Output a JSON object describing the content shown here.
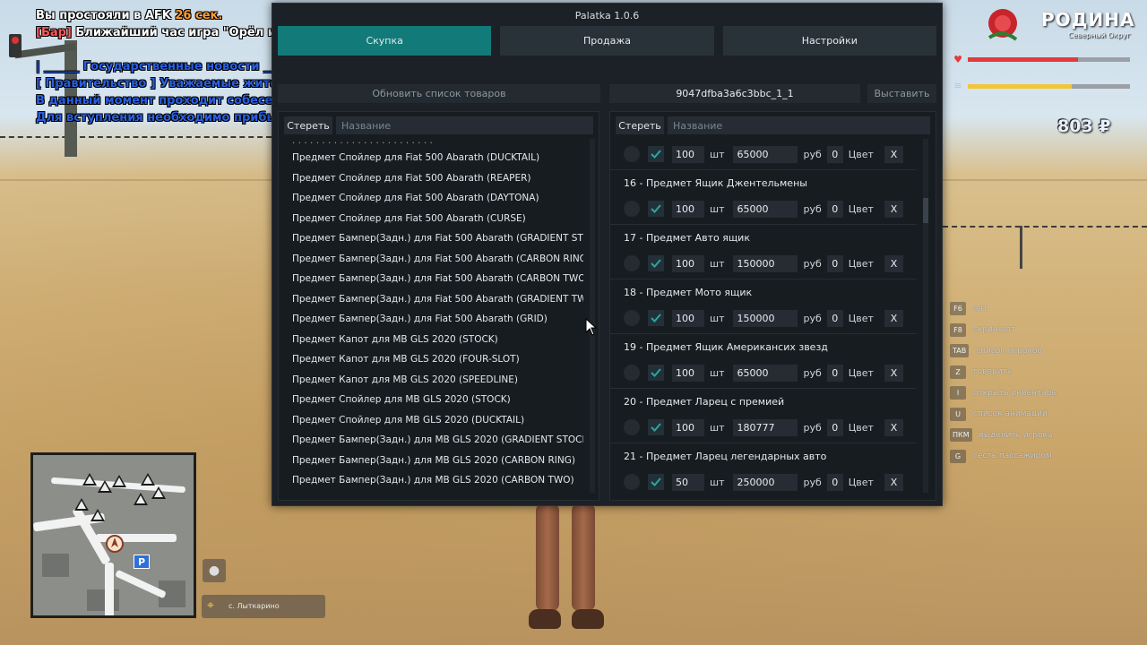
{
  "chat": {
    "line1_prefix": "Вы простояли в AFK ",
    "line1_value": "26 сек.",
    "line2_tag": "[Бар]",
    "line2_text": " Ближайший час игра \"Орёл и Ре",
    "line3": "| ______ Государственные новости ______",
    "line4": "[ Правительство ] Уважаемые жители с",
    "line5": "В данный момент проходит собеседов",
    "line6": "Для вступления необходимо прибыть"
  },
  "dialog": {
    "title": "Palatka 1.0.6",
    "tabs": [
      {
        "label": "Скупка",
        "active": true
      },
      {
        "label": "Продажа",
        "active": false
      },
      {
        "label": "Настройки",
        "active": false
      }
    ],
    "left": {
      "refresh_label": "Обновить список товаров",
      "clear_label": "Стереть",
      "search_placeholder": "Название",
      "items": [
        "Предмет Спойлер для Fiat 500 Abarath (DUCKTAIL)",
        "Предмет Спойлер для Fiat 500 Abarath (REAPER)",
        "Предмет Спойлер для Fiat 500 Abarath (DAYTONA)",
        "Предмет Спойлер для Fiat 500 Abarath (CURSE)",
        "Предмет Бампер(Задн.) для Fiat 500 Abarath (GRADIENT ST",
        "Предмет Бампер(Задн.) для Fiat 500 Abarath (CARBON RING",
        "Предмет Бампер(Задн.) для Fiat 500 Abarath (CARBON TWO",
        "Предмет Бампер(Задн.) для Fiat 500 Abarath (GRADIENT TW",
        "Предмет Бампер(Задн.) для Fiat 500 Abarath (GRID)",
        "Предмет Капот для MB GLS 2020 (STOCK)",
        "Предмет Капот для MB GLS 2020 (FOUR-SLOT)",
        "Предмет Капот для MB GLS 2020 (SPEEDLINE)",
        "Предмет Спойлер для MB GLS 2020 (STOCK)",
        "Предмет Спойлер для MB GLS 2020 (DUCKTAIL)",
        "Предмет Бампер(Задн.) для MB GLS 2020 (GRADIENT STOCK",
        "Предмет Бампер(Задн.) для MB GLS 2020 (CARBON RING)",
        "Предмет Бампер(Задн.) для MB GLS 2020 (CARBON TWO)"
      ]
    },
    "right": {
      "code": "9047dfba3a6c3bbc_1_1",
      "apply_label": "Выставить",
      "clear_label": "Стереть",
      "search_placeholder": "Название",
      "unit_label": "шт",
      "currency_label": "руб",
      "color_label": "Цвет",
      "remove_label": "X",
      "first_row": {
        "qty": "100",
        "price": "65000",
        "color": "0"
      },
      "rows": [
        {
          "title": "16 - Предмет Ящик Джентельмены",
          "qty": "100",
          "price": "65000",
          "color": "0"
        },
        {
          "title": "17 - Предмет Авто ящик",
          "qty": "100",
          "price": "150000",
          "color": "0"
        },
        {
          "title": "18 - Предмет Мото ящик",
          "qty": "100",
          "price": "150000",
          "color": "0"
        },
        {
          "title": "19 - Предмет Ящик Американсих звезд",
          "qty": "100",
          "price": "65000",
          "color": "0"
        },
        {
          "title": "20 - Предмет Ларец с премией",
          "qty": "100",
          "price": "180777",
          "color": "0"
        },
        {
          "title": "21 - Предмет Ларец легендарных авто",
          "qty": "50",
          "price": "250000",
          "color": "0"
        }
      ]
    }
  },
  "hud": {
    "logo": "РОДИНА",
    "logo_sub": "Северный Округ",
    "money": "803 ₽",
    "health_fraction": 0.68,
    "hunger_fraction": 0.64,
    "health_color": "#e23b3b",
    "hunger_color": "#f2c53a",
    "hints": [
      {
        "key": "F6",
        "text": "чат"
      },
      {
        "key": "F8",
        "text": "скриншот"
      },
      {
        "key": "TAB",
        "text": "список игроков"
      },
      {
        "key": "Z",
        "text": "говорить"
      },
      {
        "key": "I",
        "text": "открыть инвентарь"
      },
      {
        "key": "U",
        "text": "список анимаций"
      },
      {
        "key": "ПКМ",
        "text": "выделить игрока"
      },
      {
        "key": "G",
        "text": "сесть пассажиром"
      }
    ],
    "location": "с. Лыткарино"
  }
}
